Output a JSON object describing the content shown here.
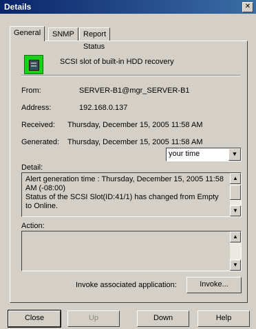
{
  "window": {
    "title": "Details",
    "close_glyph": "✕"
  },
  "tabs": [
    {
      "label": "General"
    },
    {
      "label": "SNMP"
    },
    {
      "label": "Report Status"
    }
  ],
  "general": {
    "headline": "SCSI slot of built-in HDD recovery",
    "fields": {
      "from": {
        "label": "From:",
        "value": "SERVER-B1@mgr_SERVER-B1"
      },
      "address": {
        "label": "Address:",
        "value": "192.168.0.137"
      },
      "received": {
        "label": "Received:",
        "value": "Thursday, December 15, 2005 11:58 AM"
      },
      "generated": {
        "label": "Generated:",
        "value": "Thursday, December 15, 2005 11:58 AM"
      }
    },
    "time_select": {
      "value": "your time"
    },
    "detail": {
      "label": "Detail:",
      "text": "Alert generation time : Thursday, December 15, 2005 11:58 AM (-08:00)\nStatus of the SCSI Slot(ID:41/1) has changed from Empty to Online."
    },
    "action": {
      "label": "Action:",
      "text": ""
    },
    "invoke": {
      "label": "Invoke associated application:",
      "button_label": "Invoke..."
    }
  },
  "buttons": {
    "close": "Close",
    "up": "Up",
    "down": "Down",
    "help": "Help"
  }
}
